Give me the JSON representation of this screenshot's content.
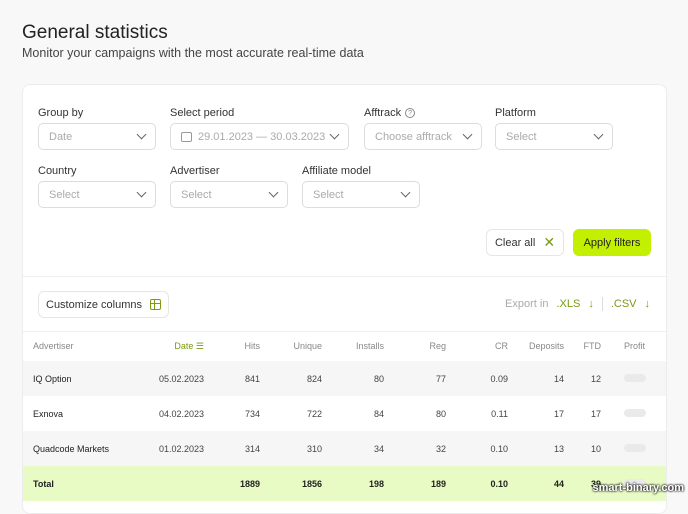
{
  "header": {
    "title": "General statistics",
    "subtitle": "Monitor your campaigns with the most accurate real-time data"
  },
  "filters": {
    "group_by": {
      "label": "Group by",
      "value": "Date"
    },
    "period": {
      "label": "Select period",
      "value": "29.01.2023 — 30.03.2023"
    },
    "afftrack": {
      "label": "Afftrack",
      "placeholder": "Choose afftrack"
    },
    "platform": {
      "label": "Platform",
      "placeholder": "Select"
    },
    "country": {
      "label": "Country",
      "placeholder": "Select"
    },
    "advertiser": {
      "label": "Advertiser",
      "placeholder": "Select"
    },
    "affiliate_model": {
      "label": "Affiliate model",
      "placeholder": "Select"
    },
    "clear_label": "Clear all",
    "apply_label": "Apply filters"
  },
  "toolbar": {
    "customize_label": "Customize columns",
    "export_label": "Export in",
    "xls": ".XLS",
    "csv": ".CSV"
  },
  "table": {
    "columns": [
      "Advertiser",
      "Date",
      "Hits",
      "Unique",
      "Installs",
      "Reg",
      "CR",
      "Deposits",
      "FTD",
      "Profit"
    ],
    "rows": [
      [
        "IQ Option",
        "05.02.2023",
        "841",
        "824",
        "80",
        "77",
        "0.09",
        "14",
        "12"
      ],
      [
        "Exnova",
        "04.02.2023",
        "734",
        "722",
        "84",
        "80",
        "0.11",
        "17",
        "17"
      ],
      [
        "Quadcode Markets",
        "01.02.2023",
        "314",
        "310",
        "34",
        "32",
        "0.10",
        "13",
        "10"
      ]
    ],
    "total": [
      "Total",
      "",
      "1889",
      "1856",
      "198",
      "189",
      "0.10",
      "44",
      "39"
    ]
  },
  "colors": {
    "accent": "#c2f000",
    "accent_text": "#7a9a12",
    "total_row": "#e8fbc4"
  },
  "watermark": "smart-binary.com"
}
